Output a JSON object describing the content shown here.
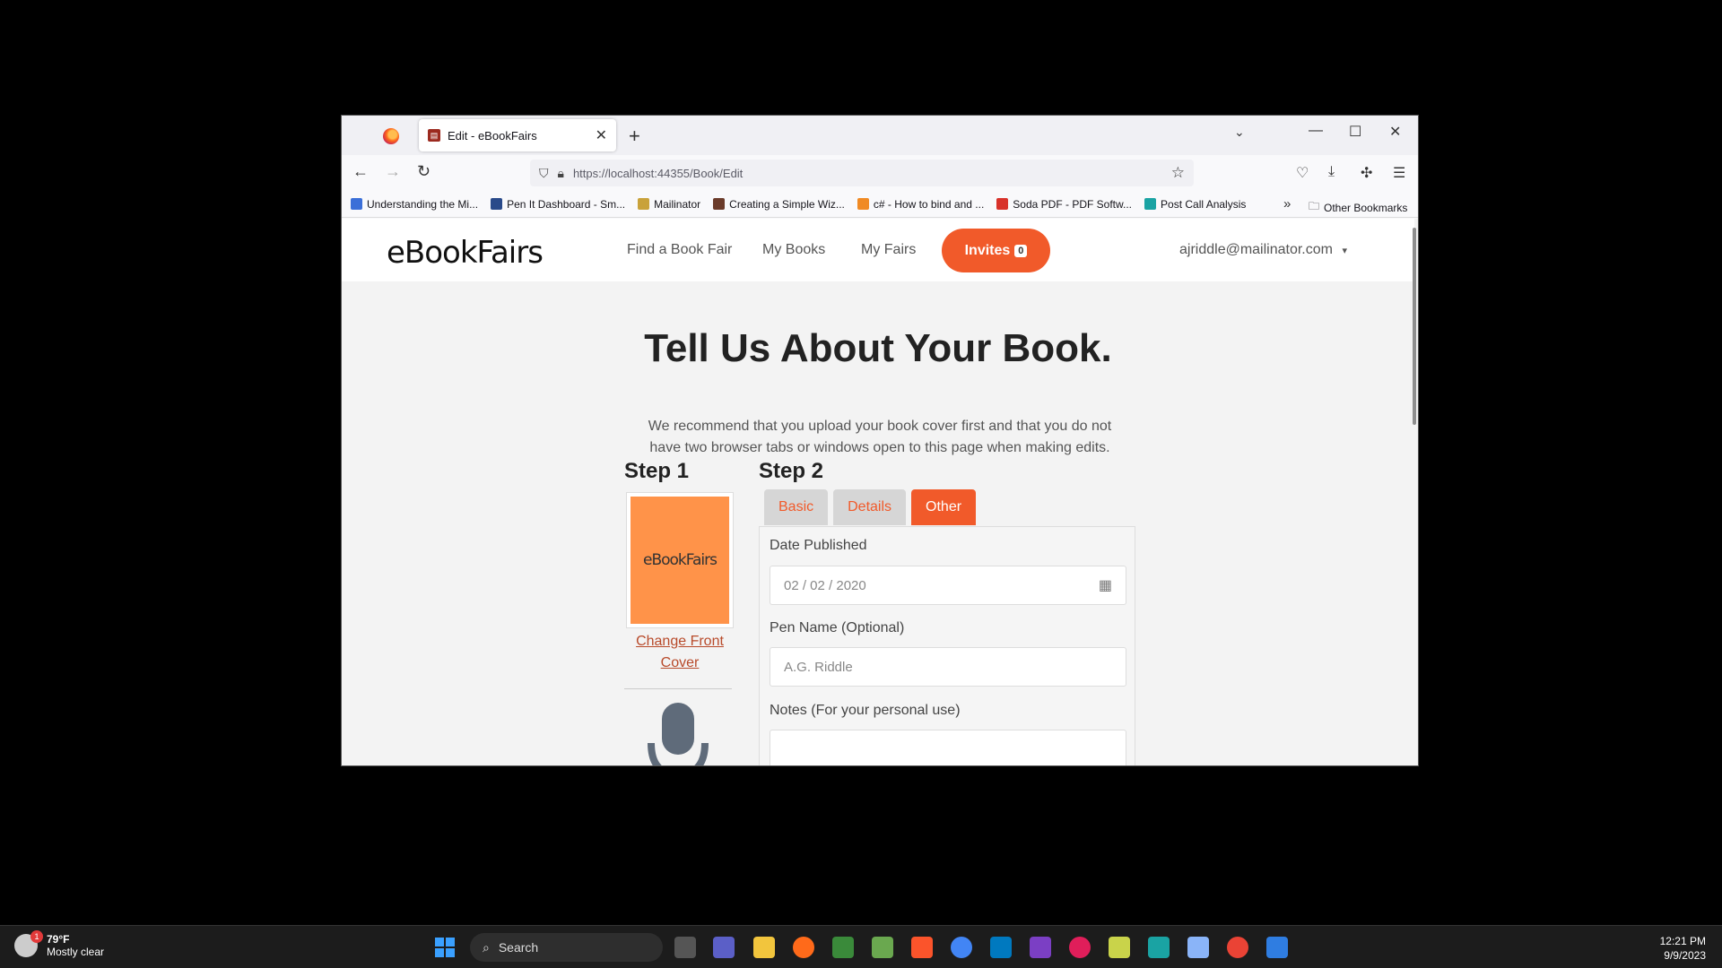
{
  "browser": {
    "tab_title": "Edit - eBookFairs",
    "url": "https://localhost:44355/Book/Edit",
    "bookmarks": [
      {
        "label": "Understanding the Mi...",
        "color": "#3b6fd8"
      },
      {
        "label": "Pen It Dashboard - Sm...",
        "color": "#2a4a8a"
      },
      {
        "label": "Mailinator",
        "color": "#c9a23a"
      },
      {
        "label": "Creating a Simple Wiz...",
        "color": "#6b3b2a"
      },
      {
        "label": "c# - How to bind and ...",
        "color": "#f08a24"
      },
      {
        "label": "Soda PDF - PDF Softw...",
        "color": "#d8322a"
      },
      {
        "label": "Post Call Analysis",
        "color": "#1aa3a3"
      }
    ],
    "other_bookmarks": "Other Bookmarks"
  },
  "site": {
    "logo": "eBookFairs",
    "nav": {
      "find": "Find a Book Fair",
      "my_books": "My Books",
      "my_fairs": "My Fairs",
      "invites": "Invites",
      "invites_count": "0",
      "user": "ajriddle@mailinator.com"
    },
    "title": "Tell Us About Your Book.",
    "intro": "We recommend that you upload your book cover first and that you do not have two browser tabs or windows open to this page when making edits.",
    "step1": "Step 1",
    "step2": "Step 2",
    "cover_text": "eBookFairs",
    "change_cover": "Change Front Cover",
    "tabs": {
      "basic": "Basic",
      "details": "Details",
      "other": "Other"
    },
    "form": {
      "date_label": "Date Published",
      "date_value": "02 / 02 / 2020",
      "pen_label": "Pen Name (Optional)",
      "pen_placeholder": "A.G. Riddle",
      "notes_label": "Notes (For your personal use)"
    },
    "accent_color": "#f15a2a"
  },
  "taskbar": {
    "weather_temp": "79°F",
    "weather_desc": "Mostly clear",
    "weather_badge": "1",
    "search": "Search",
    "time": "12:21 PM",
    "date": "9/9/2023"
  }
}
